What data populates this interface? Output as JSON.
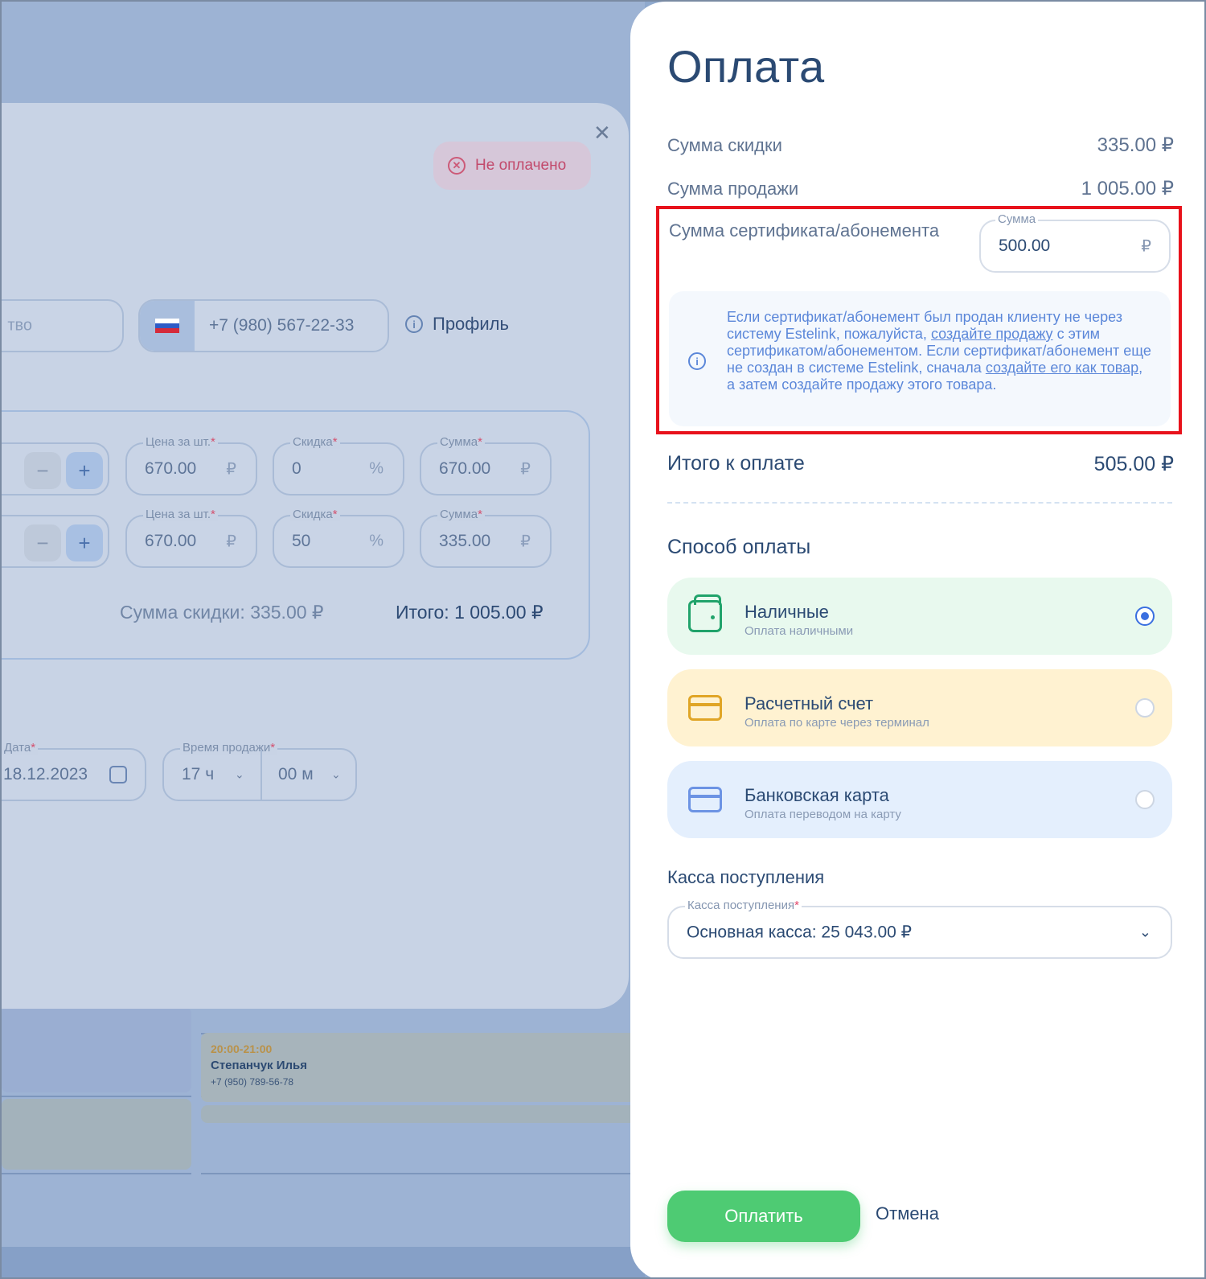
{
  "background": {
    "status_badge": "Не оплачено",
    "client_field_fragment": "тво",
    "phone": "+7 (980) 567-22-33",
    "profile_link": "Профиль",
    "items": [
      {
        "price_label": "Цена за шт.",
        "price": "670.00",
        "discount_label": "Скидка",
        "discount": "0",
        "sum_label": "Сумма",
        "sum": "670.00"
      },
      {
        "price_label": "Цена за шт.",
        "price": "670.00",
        "discount_label": "Скидка",
        "discount": "50",
        "sum_label": "Сумма",
        "sum": "335.00"
      }
    ],
    "currency": "₽",
    "percent": "%",
    "minus": "−",
    "plus": "+",
    "discount_total_label": "Сумма скидки:",
    "discount_total_value": "335.00 ₽",
    "grand_total_label": "Итого:",
    "grand_total_value": "1 005.00 ₽",
    "date_label": "Дата",
    "date_value": "18.12.2023",
    "time_label": "Время продажи",
    "hour_value": "17 ч",
    "minute_value": "00 м",
    "event": {
      "time": "20:00-21:00",
      "name": "Степанчук Илья",
      "phone": "+7 (950) 789-56-78"
    }
  },
  "payment": {
    "title": "Оплата",
    "discount_label": "Сумма скидки",
    "discount_value": "335.00 ₽",
    "sale_label": "Сумма продажи",
    "sale_value": "1 005.00 ₽",
    "certificate_label": "Сумма сертификата/абонемента",
    "sum_field_label": "Сумма",
    "sum_field_value": "500.00",
    "sum_field_currency": "₽",
    "info": {
      "part1": "Если сертификат/абонемент был продан клиенту не через систему Estelink, пожалуйста, ",
      "link1": "создайте продажу",
      "part2": " с этим сертификатом/абонементом. Если сертификат/абонемент еще не создан в системе Estelink, сначала ",
      "link2": "создайте его как товар",
      "part3": ", а затем создайте продажу этого товара."
    },
    "total_label": "Итого к оплате",
    "total_value": "505.00 ₽",
    "method_title": "Способ оплаты",
    "methods": [
      {
        "name": "Наличные",
        "sub": "Оплата наличными",
        "selected": true,
        "icon": "wallet-icon",
        "color": "#21a36b"
      },
      {
        "name": "Расчетный счет",
        "sub": "Оплата по карте через терминал",
        "selected": false,
        "icon": "card-icon",
        "color": "#e0a526"
      },
      {
        "name": "Банковская карта",
        "sub": "Оплата переводом на карту",
        "selected": false,
        "icon": "card-icon",
        "color": "#6c93e4"
      }
    ],
    "kassa_title": "Касса поступления",
    "kassa_field_label": "Касса поступления",
    "kassa_value": "Основная касса: 25 043.00 ₽",
    "pay_button": "Оплатить",
    "cancel_button": "Отмена"
  }
}
